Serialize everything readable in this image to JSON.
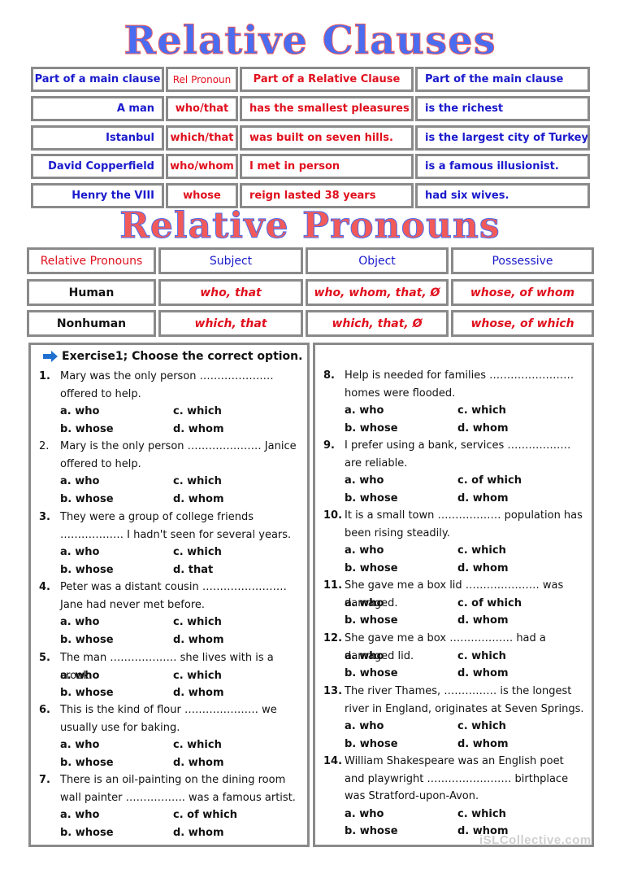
{
  "titles": {
    "clauses": "Relative Clauses",
    "pronouns": "Relative Pronouns"
  },
  "clauses_table": {
    "header": [
      "Part of a main clause",
      "Rel Pronoun",
      "Part of a Relative Clause",
      "Part of the main clause"
    ],
    "rows": [
      [
        "A man",
        "who/that",
        "has the smallest pleasures",
        "is the richest"
      ],
      [
        "Istanbul",
        "which/that",
        "was built on seven hills.",
        "is the largest city of Turkey"
      ],
      [
        "David Copperfield",
        "who/whom",
        "I met in person",
        "is a famous illusionist."
      ],
      [
        "Henry the VIII",
        "whose",
        "reign lasted 38 years",
        "had six wives."
      ]
    ]
  },
  "pronouns_table": {
    "header": [
      "Relative Pronouns",
      "Subject",
      "Object",
      "Possessive"
    ],
    "rows": [
      [
        "Human",
        "who, that",
        "who, whom, that, Ø",
        "whose, of whom"
      ],
      [
        "Nonhuman",
        "which, that",
        "which, that, Ø",
        "whose, of which"
      ]
    ]
  },
  "exercise": {
    "heading": "Exercise1; Choose the correct option.",
    "heading_icon": "arrow-right-icon",
    "questions": [
      {
        "num": "1.",
        "text": "Mary was the only person ………………… offered to help.",
        "options": [
          "a. who",
          "b. whose",
          "c. which",
          "d. whom"
        ]
      },
      {
        "num": "2.",
        "text": "Mary is the only person ………………… Janice offered to help.",
        "options": [
          "a. who",
          "b. whose",
          "c. which",
          "d. whom"
        ]
      },
      {
        "num": "3.",
        "text": "They were a group of college friends ……………… I hadn't seen for several years.",
        "options": [
          "a. who",
          "b. whose",
          "c. which",
          "d. that"
        ]
      },
      {
        "num": "4.",
        "text": "Peter was a distant cousin …………………… Jane had never met before.",
        "options": [
          "a. who",
          "b. whose",
          "c. which",
          "d. whom"
        ]
      },
      {
        "num": "5.",
        "text": "The man ………………. she lives with is a crook.",
        "options": [
          "a. who",
          "b. whose",
          "c. which",
          "d. whom"
        ]
      },
      {
        "num": "6.",
        "text": "This is the kind of flour ………………… we usually use for baking.",
        "options": [
          "a. who",
          "b. whose",
          "c. which",
          "d. whom"
        ]
      },
      {
        "num": "7.",
        "text": "There is an oil-painting on the dining room wall painter …………….. was a famous artist.",
        "options": [
          "a. who",
          "b. whose",
          "c. of which",
          "d. whom"
        ]
      },
      {
        "num": "8.",
        "text": "Help is needed for families …………………… homes were flooded.",
        "options": [
          "a. who",
          "b. whose",
          "c. which",
          "d. whom"
        ]
      },
      {
        "num": "9.",
        "text": "I prefer using a bank, services ……………… are reliable.",
        "options": [
          "a. who",
          "b. whose",
          "c. of which",
          "d. whom"
        ]
      },
      {
        "num": "10.",
        "text": "It is a small town ……………… population has been rising steadily.",
        "options": [
          "a. who",
          "b. whose",
          "c. which",
          "d. whom"
        ]
      },
      {
        "num": "11.",
        "text": "She gave me a box lid ………………… was damaged.",
        "options": [
          "a. who",
          "b. whose",
          "c. of which",
          "d. whom"
        ]
      },
      {
        "num": "12.",
        "text": "She gave me a box ……………… had a damaged lid.",
        "options": [
          "a. who",
          "b. whose",
          "c. which",
          "d. whom"
        ]
      },
      {
        "num": "13.",
        "text": "The river Thames, …………… is the longest river in England, originates at Seven Springs.",
        "options": [
          "a. who",
          "b. whose",
          "c. which",
          "d. whom"
        ]
      },
      {
        "num": "14.",
        "text": "William Shakespeare was an English poet and playwright …………………… birthplace was Stratford-upon-Avon.",
        "options": [
          "a. who",
          "b. whose",
          "c. which",
          "d. whom"
        ]
      }
    ]
  },
  "watermark": "iSLCollective.com",
  "colors": {
    "blue_text": "#1a1acc",
    "red_text": "#e0101e",
    "border": "#8a8a8a"
  }
}
